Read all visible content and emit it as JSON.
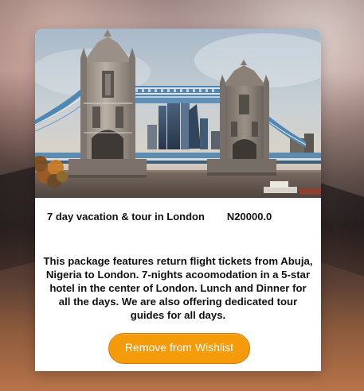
{
  "card": {
    "image": {
      "alt": "Tower Bridge in London"
    },
    "tour_name": "7 day vacation & tour in London",
    "price": "N20000.0",
    "description": "This package features return flight tickets from Abuja, Nigeria to London. 7-nights acoomodation in a 5-star hotel in the center of London. Lunch and Dinner for all the days. We are also offering dedicated tour guides for all days.",
    "remove_button_label": "Remove from Wishlist"
  },
  "colors": {
    "accent": "#f59a08",
    "card_background": "#ffffff",
    "text_primary": "#111111"
  }
}
